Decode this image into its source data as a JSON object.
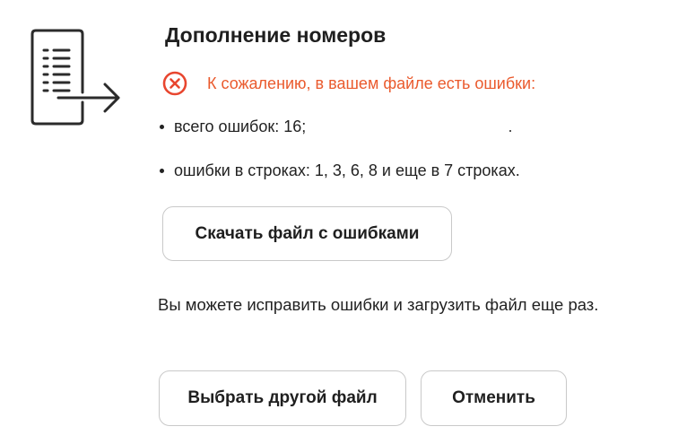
{
  "dialog": {
    "title": "Дополнение номеров",
    "icon": "document-export-icon",
    "error": {
      "icon": "error-circle-x-icon",
      "color": "#ea5a2d",
      "text": "К сожалению, в вашем файле есть ошибки:"
    },
    "details": [
      "всего ошибок: 16;",
      "ошибки в строках: 1, 3, 6, 8 и еще в 7 строках."
    ],
    "download_button": "Скачать файл с ошибками",
    "info_text": "Вы можете исправить ошибки и загрузить файл еще раз.",
    "choose_button": "Выбрать другой файл",
    "cancel_button": "Отменить"
  }
}
